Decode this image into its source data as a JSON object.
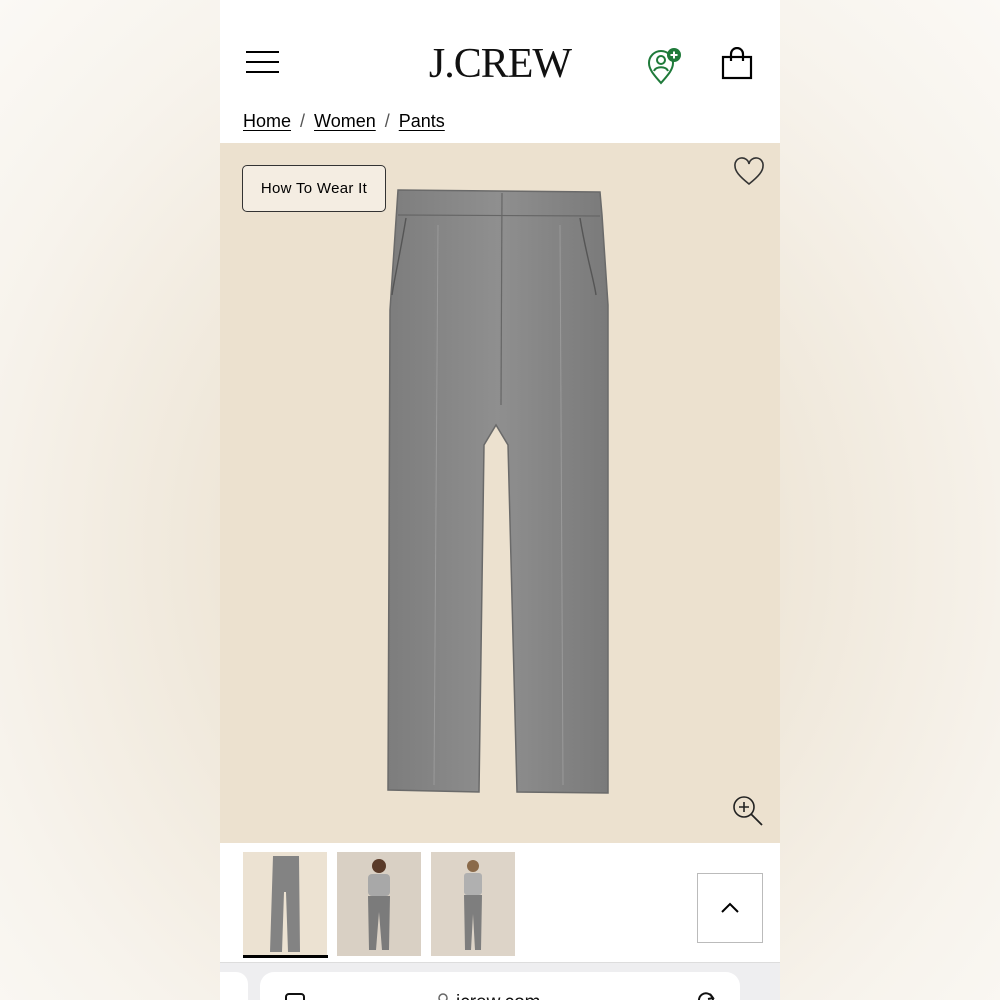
{
  "header": {
    "logo": "J.CREW",
    "menu_icon": "hamburger-icon",
    "account_icon": "account-location-icon",
    "bag_icon": "shopping-bag-icon",
    "account_badge_color": "#1f7a3a"
  },
  "breadcrumb": [
    {
      "label": "Home"
    },
    {
      "label": "Women"
    },
    {
      "label": "Pants"
    }
  ],
  "breadcrumb_separator": "/",
  "hero": {
    "how_to_wear_label": "How To Wear It",
    "wishlist_icon": "heart-icon",
    "zoom_icon": "zoom-in-icon",
    "background": "#ece1cf"
  },
  "thumbnails": [
    {
      "name": "flat-lay-pants",
      "active": true
    },
    {
      "name": "model-front-1",
      "active": false
    },
    {
      "name": "model-front-2",
      "active": false
    }
  ],
  "back_to_top_icon": "chevron-up-icon",
  "browser": {
    "url": "jcrew.com"
  }
}
